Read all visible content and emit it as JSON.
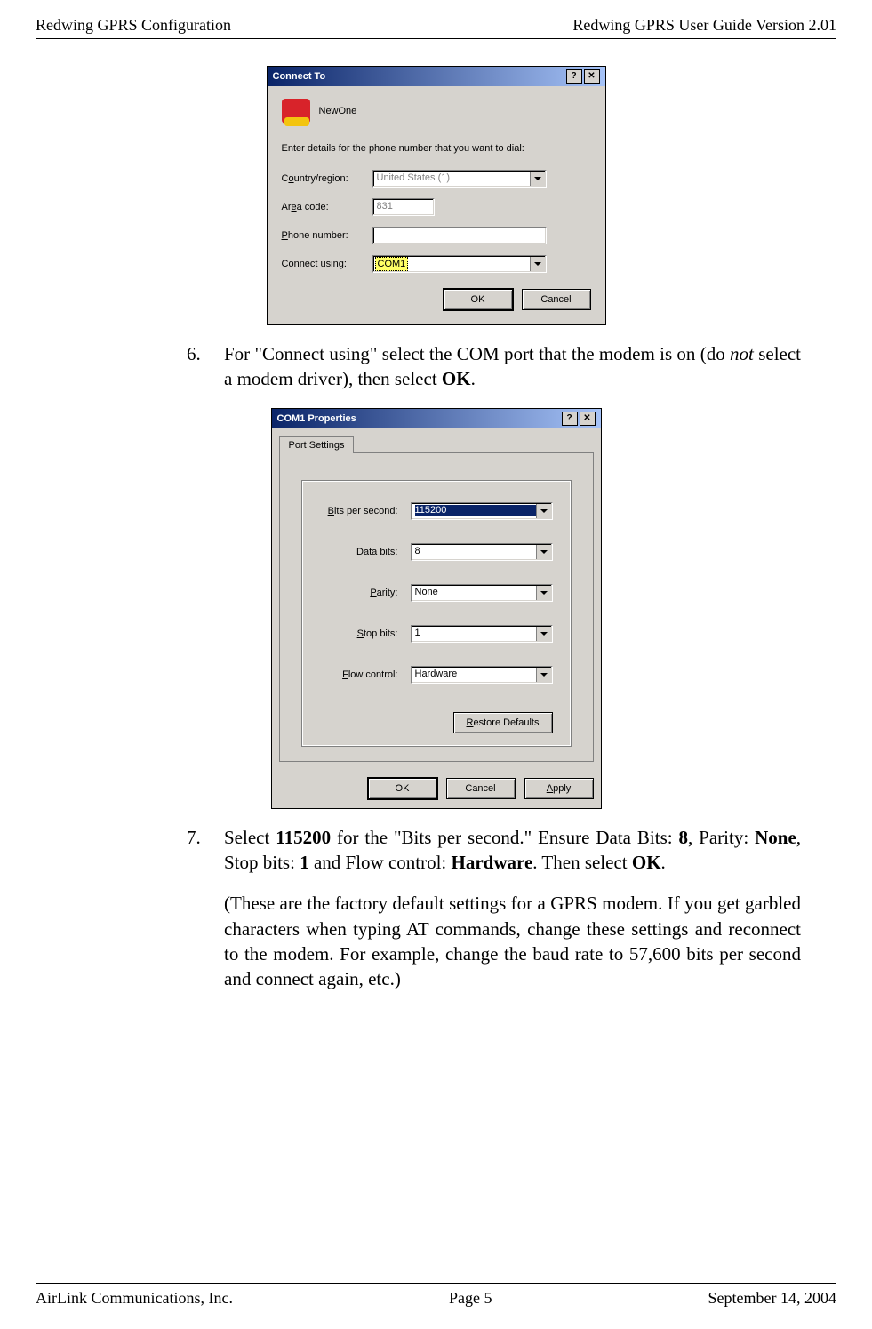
{
  "header": {
    "left": "Redwing GPRS Configuration",
    "right": "Redwing GPRS User Guide Version 2.01"
  },
  "footer": {
    "left": "AirLink Communications, Inc.",
    "mid": "Page 5",
    "right": "September 14, 2004"
  },
  "step6": {
    "num": "6.",
    "text_a": "For \"Connect using\" select the COM port that the modem is on (do ",
    "text_i": "not",
    "text_b": " select a modem driver), then select ",
    "text_bold": "OK",
    "text_c": "."
  },
  "step7": {
    "num": "7.",
    "p1_a": "Select ",
    "p1_b1": "115200",
    "p1_b": " for the \"Bits per second.\" Ensure Data Bits: ",
    "p1_b2": "8",
    "p1_c": ", Parity: ",
    "p1_b3": "None",
    "p1_d": ", Stop bits: ",
    "p1_b4": "1",
    "p1_e": " and Flow control: ",
    "p1_b5": "Hardware",
    "p1_f": ". Then select ",
    "p1_b6": "OK",
    "p1_g": "."
  },
  "note": "(These are the factory default settings for a GPRS modem. If you get garbled characters when typing AT commands, change these settings and reconnect to the modem. For example, change the baud rate to 57,600 bits per second and connect again, etc.)",
  "dlg1": {
    "title": "Connect To",
    "name": "NewOne",
    "intro": "Enter details for the phone number that you want to dial:",
    "country_lbl_pre": "C",
    "country_lbl_u": "o",
    "country_lbl_post": "untry/region:",
    "country_val": "United States (1)",
    "area_lbl_pre": "Ar",
    "area_lbl_u": "e",
    "area_lbl_post": "a code:",
    "area_val": "831",
    "phone_lbl_u": "P",
    "phone_lbl_post": "hone number:",
    "phone_val": "",
    "conn_lbl_pre": "Co",
    "conn_lbl_u": "n",
    "conn_lbl_post": "nect using:",
    "conn_val": "COM1",
    "ok": "OK",
    "cancel": "Cancel",
    "help": "?",
    "close": "✕"
  },
  "dlg2": {
    "title": "COM1 Properties",
    "tab": "Port Settings",
    "bits_lbl_u": "B",
    "bits_lbl_post": "its per second:",
    "bits_val": "115200",
    "data_lbl_u": "D",
    "data_lbl_post": "ata bits:",
    "data_val": "8",
    "par_lbl_u": "P",
    "par_lbl_post": "arity:",
    "par_val": "None",
    "stop_lbl_u": "S",
    "stop_lbl_post": "top bits:",
    "stop_val": "1",
    "flow_lbl_u": "F",
    "flow_lbl_post": "low control:",
    "flow_val": "Hardware",
    "restore_u": "R",
    "restore_post": "estore Defaults",
    "ok": "OK",
    "cancel": "Cancel",
    "apply_u": "A",
    "apply_post": "pply",
    "help": "?",
    "close": "✕"
  }
}
